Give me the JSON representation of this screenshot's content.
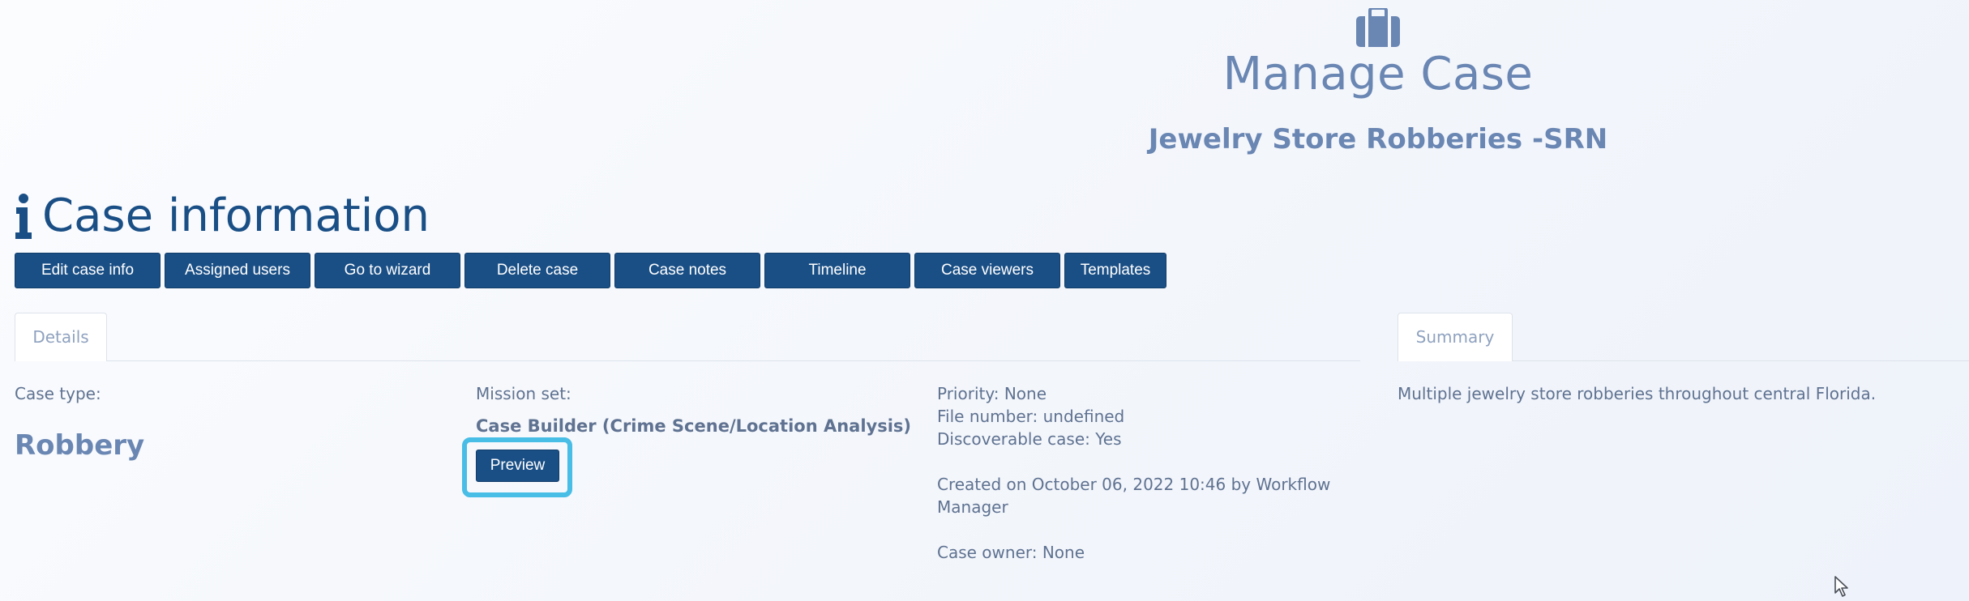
{
  "header": {
    "icon": "briefcase-icon",
    "title": "Manage Case",
    "subtitle": "Jewelry Store Robberies -SRN"
  },
  "section": {
    "icon": "info-icon",
    "title": "Case information"
  },
  "toolbar": {
    "buttons": [
      "Edit case info",
      "Assigned users",
      "Go to wizard",
      "Delete case",
      "Case notes",
      "Timeline",
      "Case viewers",
      "Templates"
    ]
  },
  "tabs": {
    "details": "Details",
    "summary": "Summary"
  },
  "details": {
    "case_type_label": "Case type:",
    "case_type_value": "Robbery",
    "mission_set_label": "Mission set:",
    "mission_set_value": "Case Builder (Crime Scene/Location Analysis)",
    "preview_label": "Preview",
    "priority": "Priority: None",
    "file_number": "File number: undefined",
    "discoverable": "Discoverable case: Yes",
    "created_line1": "Created on October 06, 2022 10:46 by Workflow",
    "created_line2": "Manager",
    "case_owner": "Case owner: None"
  },
  "summary": {
    "text": "Multiple jewelry store robberies throughout central Florida."
  },
  "colors": {
    "primary_button": "#1a4f86",
    "heading": "#1a4f86",
    "accent_text": "#6a86b3",
    "highlight": "#48bde6"
  }
}
